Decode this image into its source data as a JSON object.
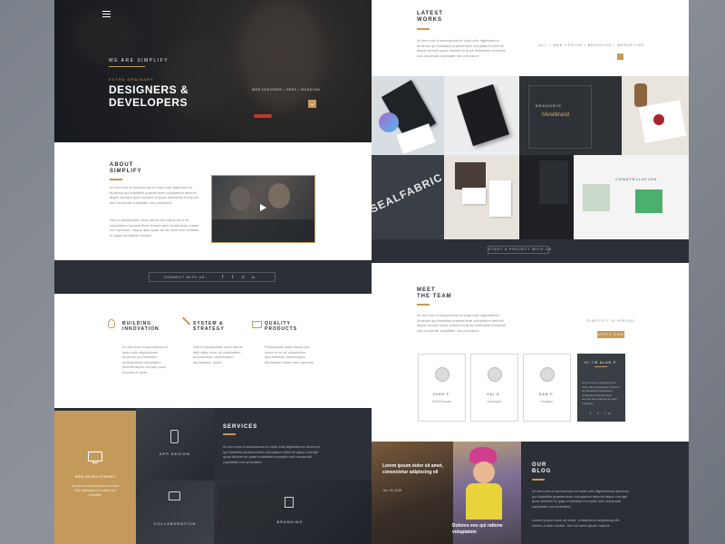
{
  "hero": {
    "tagline": "WE ARE SIMPLIFY",
    "kicker": "EXTRA-ORDINARY",
    "title_line1": "DESIGNERS &",
    "title_line2": "DEVELOPERS",
    "subtitle": "WEB DESIGNER • GEEK • MUSICIAN"
  },
  "about": {
    "title_line1": "ABOUT",
    "title_line2": "SIMPLIFY",
    "para1": "At vero eos et accusamus et iusto odio dignissimos ducimus qui blanditiis praesentium voluptatum deleniti atque corrupti quos dolores et quas molestias excepturi sint occaecati cupiditate non provident.",
    "para2": "Sed ut perspiciatis unde omnis iste natus error sit voluptatem accusantium doloremque laudantium, totam rem aperiam, eaque ipsa quae ab illo inventore veritatis et quasi architecto beatae."
  },
  "connect": {
    "label": "CONNECT WITH US:",
    "icons": [
      "f",
      "t",
      "v",
      "in"
    ]
  },
  "features": [
    {
      "title1": "BUILDING",
      "title2": "INNOVATION",
      "text": "At vero eos et accusamus et iusto odio dignissimos ducimus qui blanditiis praesentium voluptatum deleniti atque corrupti quos dolores et quas"
    },
    {
      "title1": "SYSTEM &",
      "title2": "STRATEGY",
      "text": "Sed ut perspiciatis unde omnis iste natus error sit voluptatem accusantium doloremque laudantium, totam"
    },
    {
      "title1": "QUALITY",
      "title2": "PRODUCTS",
      "text": "Perspiciatis unde omnis iste natus error sit voluptatem accusantium doloremque laudantium totam rem aperiam"
    }
  ],
  "services": {
    "title": "SERVICES",
    "text": "At vero eos et accusamus et iusto odio dignissimos ducimus qui blanditiis praesentium voluptatum deleniti atque corrupti quos dolores et quas molestias excepturi sint occaecati cupiditate non provident.",
    "web_dev": "WEB DEVELOPMENT",
    "web_dev_text": "At vero eos et accusamus et iusto odio dignissimos ducimus qui blanditiis",
    "app_design": "APP DESIGN",
    "collaboration": "COLLABORATION",
    "branding": "BRANDING"
  },
  "works": {
    "title_line1": "LATEST",
    "title_line2": "WORKS",
    "text": "At vero eos et accusamus et iusto odio dignissimos ducimus qui blanditiis praesentium voluptatum deleniti atque corrupti quos dolores et quas molestias excepturi sint occaecati cupiditate non provident.",
    "filters": "ALL • WEB DESIGN • BRANDING • MARKETING",
    "tile_brand": "BRANDBIG",
    "tile_brand2": "Metalbrand",
    "tile_seal": "SEALFABRIC",
    "tile_constellation": "CONSTELLATION",
    "start_button": "START A PROJECT WITH US"
  },
  "team": {
    "title_line1": "MEET",
    "title_line2": "THE TEAM",
    "text": "At vero eos et accusamus et iusto odio dignissimos ducimus qui blanditiis praesentium voluptatum deleniti atque corrupti quos dolores et quas molestias excepturi sint occaecati cupiditate non provident.",
    "hiring_label": "SIMPLIFY IS HIRING!",
    "apply_button": "APPLY NOW",
    "members": [
      {
        "name": "JOHN F.",
        "role": "CEO/Founder"
      },
      {
        "name": "KAI D.",
        "role": "Developer"
      },
      {
        "name": "DAN F.",
        "role": "Designer"
      }
    ],
    "hover_name": "HI I'M ALAN P.",
    "hover_text": "At vero eos et accusamus et iusto odio dignissimos ducimus qui blanditiis praesentium voluptatum deleniti atque corrupti quos dolores et quas molestias"
  },
  "blog": {
    "post1_title": "Lorem ipsum dolor sit amet, consectetur adipiscing eli",
    "post1_date": "Jan. 16, 2015",
    "post2_title": "Dolores eos qui ratione voluptatem",
    "title_line1": "OUR",
    "title_line2": "BLOG",
    "text": "At vero eos et accusamus et iusto odio dignissimos ducimus qui blanditiis praesentium voluptatum deleniti atque corrupti quos dolores et quas molestias excepturi sint occaecati cupiditate non provident.",
    "text2": "Lorem ipsum dolor sit amet, consectetur adipiscing elit. Donec a diam lectus. Sed sit amet ipsum mauris."
  },
  "colors": {
    "accent": "#c49a5b",
    "dark": "#2b2f36"
  }
}
